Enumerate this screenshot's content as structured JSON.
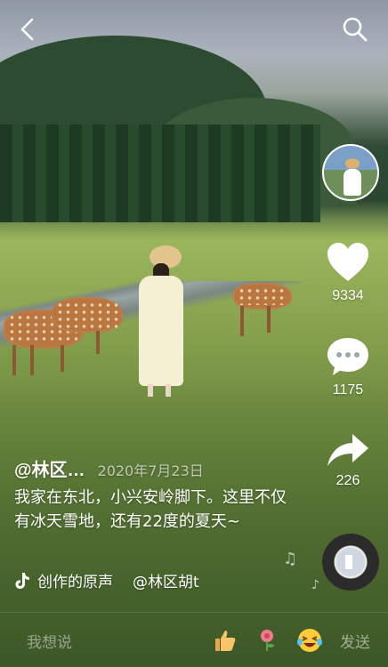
{
  "top": {
    "back_icon": "chevron-left-icon",
    "search_icon": "search-icon"
  },
  "actions": {
    "likes": "9334",
    "comments": "1175",
    "shares": "226"
  },
  "post": {
    "author": "@林区…",
    "date": "2020年7月23日",
    "caption": "我家在东北，小兴安岭脚下。这里不仅有冰天雪地，还有22度的夏天~",
    "music_label": "创作的原声",
    "music_author": "@林区胡t"
  },
  "comment_bar": {
    "placeholder": "我想说",
    "send": "发送"
  },
  "colors": {
    "accent": "#ffffff",
    "like_heart": "#ffffff"
  }
}
